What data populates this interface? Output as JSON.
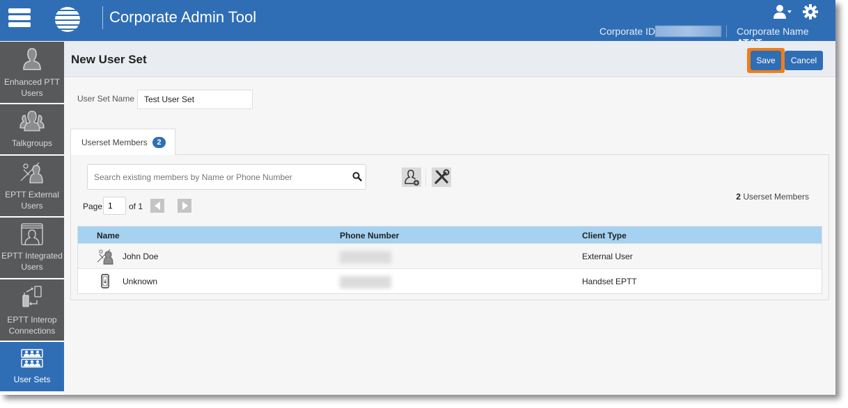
{
  "header": {
    "app_title": "Corporate Admin Tool",
    "corporate_id_label": "Corporate ID",
    "corporate_name_label": "Corporate Name",
    "corporate_name_value": "AT&T",
    "brand_color": "#2f6eb5"
  },
  "sidebar": {
    "items": [
      {
        "label_line1": "Enhanced PTT",
        "label_line2": "Users",
        "icon": "user-icon",
        "active": false
      },
      {
        "label_line1": "Talkgroups",
        "label_line2": "",
        "icon": "group-icon",
        "active": false
      },
      {
        "label_line1": "EPTT External",
        "label_line2": "Users",
        "icon": "external-user-icon",
        "active": false
      },
      {
        "label_line1": "EPTT Integrated",
        "label_line2": "Users",
        "icon": "integrated-user-icon",
        "active": false
      },
      {
        "label_line1": "EPTT Interop",
        "label_line2": "Connections",
        "icon": "interop-icon",
        "active": false
      },
      {
        "label_line1": "User Sets",
        "label_line2": "",
        "icon": "user-sets-icon",
        "active": true
      }
    ]
  },
  "page": {
    "title": "New User Set",
    "save_label": "Save",
    "cancel_label": "Cancel",
    "highlight_color": "#f07d1a",
    "user_set_name_label": "User Set Name",
    "user_set_name_value": "Test User Set"
  },
  "tab": {
    "label": "Userset Members",
    "badge": "2"
  },
  "search": {
    "placeholder": "Search existing members by Name or Phone Number",
    "value": ""
  },
  "pagination": {
    "page_label": "Page",
    "current_page": "1",
    "of_label": "of 1"
  },
  "member_count": {
    "count": "2",
    "label": "Userset Members"
  },
  "table": {
    "header_color": "#a6d2f1",
    "columns": [
      "Name",
      "Phone Number",
      "Client Type"
    ],
    "rows": [
      {
        "name": "John Doe",
        "phone": "",
        "client_type": "External User",
        "icon": "external-user-icon"
      },
      {
        "name": "Unknown",
        "phone": "",
        "client_type": "Handset EPTT",
        "icon": "handset-icon"
      }
    ]
  }
}
